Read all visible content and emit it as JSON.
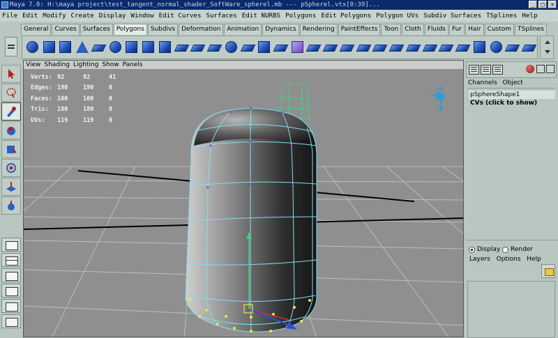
{
  "window": {
    "title": "Maya 7.0: H:\\maya project\\test_tangent_normal_shader_SoftWare_spherel.mb   ---   pSpherel.vtx[0:39]..."
  },
  "menubar": [
    "File",
    "Edit",
    "Modify",
    "Create",
    "Display",
    "Window",
    "Edit Curves",
    "Surfaces",
    "Edit NURBS",
    "Polygons",
    "Edit Polygons",
    "Polygon UVs",
    "Subdiv Surfaces",
    "TSplines",
    "Help"
  ],
  "shelf_tabs": [
    "General",
    "Curves",
    "Surfaces",
    "Polygons",
    "Subdivs",
    "Deformation",
    "Animation",
    "Dynamics",
    "Rendering",
    "PaintEffects",
    "Toon",
    "Cloth",
    "Fluids",
    "Fur",
    "Hair",
    "Custom",
    "TSplines"
  ],
  "active_shelf_tab": "Polygons",
  "shelf_icons": [
    "poly-sphere-icon",
    "poly-cube-icon",
    "poly-cylinder-icon",
    "poly-cone-icon",
    "poly-plane-icon",
    "poly-torus-icon",
    "poly-prism-icon",
    "poly-pipe-icon",
    "poly-helix-icon",
    "combine-icon",
    "separate-icon",
    "extract-icon",
    "smooth-icon",
    "boolean-icon",
    "extrude-face-icon",
    "split-polygon-icon",
    "append-icon",
    "wedge-icon",
    "poke-icon",
    "bevel-icon",
    "collapse-icon",
    "merge-icon",
    "cut-faces-icon",
    "sculpt-icon",
    "triangulate-icon",
    "quadrangulate-icon",
    "uv-planar-icon",
    "uv-cylindrical-icon",
    "uv-spherical-icon",
    "uv-auto-icon",
    "checker-icon"
  ],
  "viewport": {
    "menu": [
      "View",
      "Shading",
      "Lighting",
      "Show",
      "Panels"
    ],
    "hud": [
      {
        "label": "Verts:",
        "values": [
          "92",
          "92",
          "41"
        ]
      },
      {
        "label": "Edges:",
        "values": [
          "190",
          "190",
          "0"
        ]
      },
      {
        "label": "Faces:",
        "values": [
          "100",
          "100",
          "0"
        ]
      },
      {
        "label": "Tris:",
        "values": [
          "180",
          "180",
          "0"
        ]
      },
      {
        "label": "UVs:",
        "values": [
          "119",
          "119",
          "0"
        ]
      }
    ]
  },
  "channel_box": {
    "menu": [
      "Channels",
      "Object"
    ],
    "node": "pSphereShape1",
    "cvs": "CVs (click to show)"
  },
  "layers": {
    "display_label": "Display",
    "render_label": "Render",
    "menu": [
      "Layers",
      "Options",
      "Help"
    ]
  },
  "colors": {
    "accent": "#2b5fc8",
    "wire": "#7fe0f0",
    "grid": "#bdbdbd"
  }
}
